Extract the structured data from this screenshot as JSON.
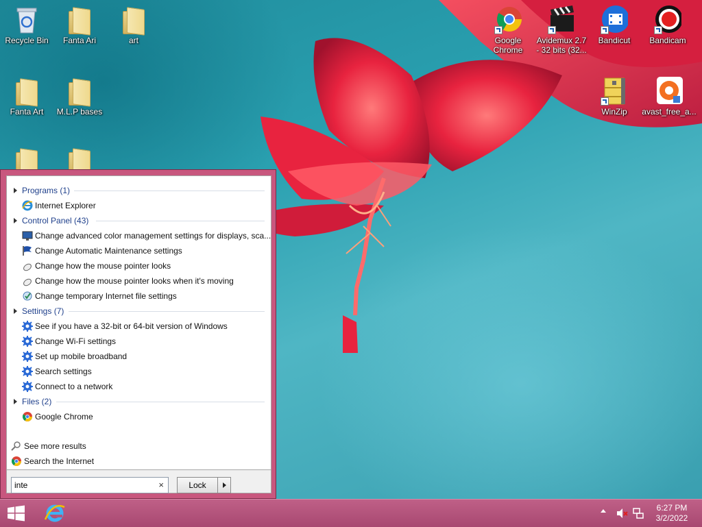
{
  "desktop": {
    "icons_left": [
      {
        "label": "Recycle Bin",
        "icon": "recycle-bin-icon"
      },
      {
        "label": "Fanta Ari",
        "icon": "folder-icon"
      },
      {
        "label": "art",
        "icon": "folder-icon"
      },
      {
        "label": "Fanta Art",
        "icon": "folder-icon"
      },
      {
        "label": "M.L.P bases",
        "icon": "folder-icon"
      }
    ],
    "icons_right": [
      {
        "label_line1": "Google",
        "label_line2": "Chrome",
        "icon": "chrome-icon"
      },
      {
        "label_line1": "Avidemux 2.7",
        "label_line2": "- 32 bits (32...",
        "icon": "clapperboard-icon"
      },
      {
        "label_line1": "Bandicut",
        "label_line2": "",
        "icon": "bandicut-icon"
      },
      {
        "label_line1": "Bandicam",
        "label_line2": "",
        "icon": "bandicam-icon"
      },
      {
        "label_line1": "WinZip",
        "label_line2": "",
        "icon": "winzip-icon"
      },
      {
        "label_line1": "avast_free_a...",
        "label_line2": "",
        "icon": "avast-icon"
      }
    ]
  },
  "search_results": {
    "groups": [
      {
        "header": "Programs (1)",
        "items": [
          "Internet Explorer"
        ]
      },
      {
        "header": "Control Panel (43)",
        "items": [
          "Change advanced color management settings for displays, sca...",
          "Change Automatic Maintenance settings",
          "Change how the mouse pointer looks",
          "Change how the mouse pointer looks when it's moving",
          "Change temporary Internet file settings"
        ]
      },
      {
        "header": "Settings (7)",
        "items": [
          "See if you have a 32-bit or 64-bit version of Windows",
          "Change Wi-Fi settings",
          "Set up mobile broadband",
          "Search settings",
          "Connect to a network"
        ]
      },
      {
        "header": "Files (2)",
        "items": [
          "Google Chrome"
        ]
      }
    ],
    "see_more": "See more results",
    "search_internet": "Search the Internet"
  },
  "search": {
    "value": "inte",
    "clear": "×"
  },
  "power": {
    "lock_label": "Lock"
  },
  "taskbar": {
    "time": "6:27 PM",
    "date": "3/2/2022"
  },
  "colors": {
    "panel_frame": "#c8577e",
    "taskbar": "#b5557c",
    "group_header": "#1e3f8b"
  }
}
